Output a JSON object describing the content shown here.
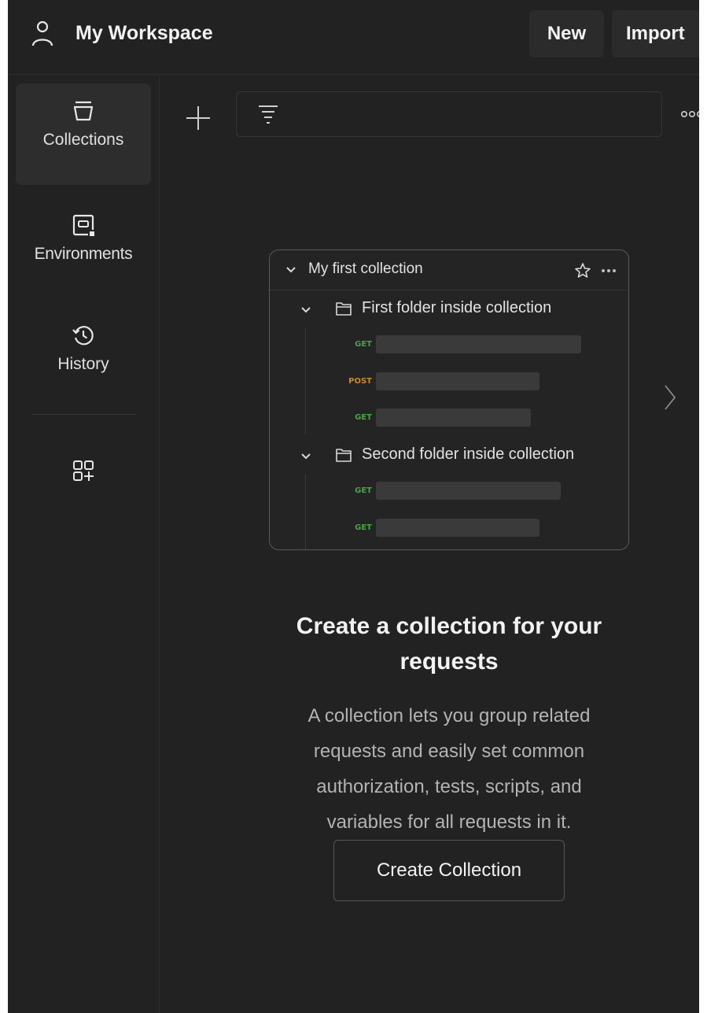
{
  "header": {
    "workspace_title": "My Workspace",
    "new_label": "New",
    "import_label": "Import"
  },
  "sidebar": {
    "items": [
      {
        "label": "Collections",
        "icon": "collections-icon",
        "active": true
      },
      {
        "label": "Environments",
        "icon": "environments-icon",
        "active": false
      },
      {
        "label": "History",
        "icon": "history-icon",
        "active": false
      },
      {
        "label": "",
        "icon": "add-apps-icon",
        "active": false
      }
    ]
  },
  "illustration": {
    "collection_name": "My first collection",
    "folders": [
      {
        "name": "First folder inside collection",
        "requests": [
          {
            "method": "GET"
          },
          {
            "method": "POST"
          },
          {
            "method": "GET"
          }
        ]
      },
      {
        "name": "Second folder inside collection",
        "requests": [
          {
            "method": "GET"
          },
          {
            "method": "GET"
          }
        ]
      }
    ]
  },
  "empty_state": {
    "heading_line1": "Create a collection for your",
    "heading_line2": "requests",
    "description_lines": [
      "A collection lets you group related",
      "requests and easily set common",
      "authorization, tests, scripts, and",
      "variables for all requests in it."
    ],
    "button_label": "Create Collection"
  },
  "colors": {
    "background": "#222222",
    "get_method": "#47a447",
    "post_method": "#c78a2c"
  }
}
